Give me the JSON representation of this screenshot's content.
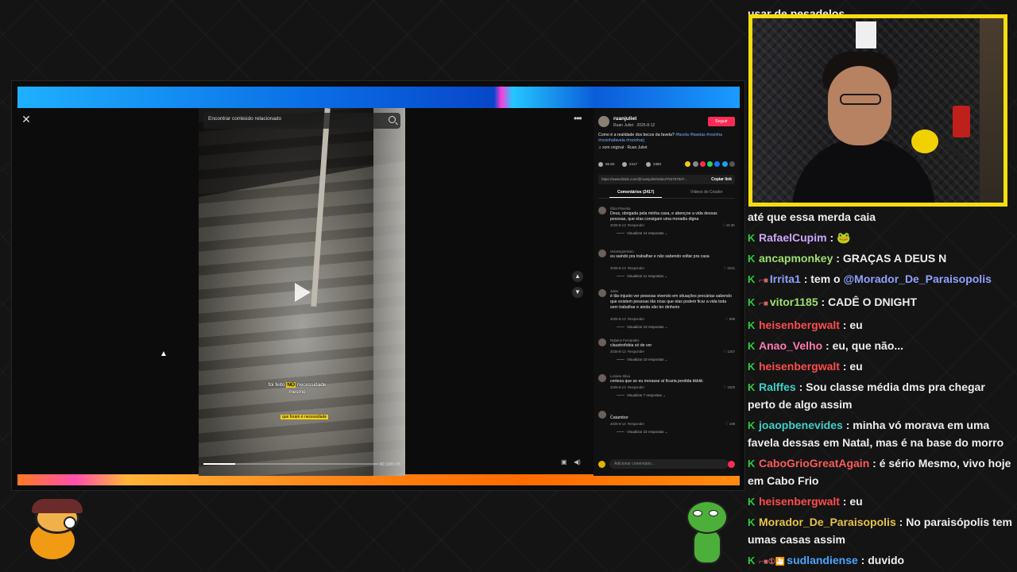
{
  "video": {
    "search_placeholder": "Encontrar conteúdo relacionado",
    "caption_prefix": "foi feito",
    "caption_highlight": "NO",
    "caption_suffix": "necessidade mesmo",
    "caption_small": "que foram é necessidade",
    "time": "00:13/01:05",
    "progress": 0.18
  },
  "panel": {
    "author": "ruanjuliet",
    "author_sub": "Ruan Juliet · 2025-8-12",
    "follow_label": "Seguir",
    "description": "Como é a realidade dos becos da favela?",
    "hashtags": "#favela #favelas #rocinha #rocinhafavela #rocinharj",
    "sound": "som original · Ruan Juliet",
    "likes": "96.5K",
    "comments_count": "2417",
    "saves": "2360",
    "link": "https://www.tiktok.com/@ruanjuliet/video/753787607...",
    "copy_link": "Copiar link",
    "tab_comments": "Comentários (2417)",
    "tab_creator": "Vídeos do Criador",
    "add_comment_placeholder": "Adicionar comentário..."
  },
  "comments": [
    {
      "user": "Ébia Pimenta",
      "text": "Deus, obrigada pela minha casa, e abençoe a vida dessas pessoas, que elas consigam uma moradia digna",
      "date": "2025-8-13",
      "reply": "Responder",
      "likes": "10.3K",
      "replies": "Visualizar 14 respostas"
    },
    {
      "user": "vivianegomesio",
      "text": "eu saindo pra trabalhar e não sabendo voltar pra casa",
      "date": "2025-8-13",
      "reply": "Responder",
      "likes": "2221",
      "replies": "Visualizar 11 respostas"
    },
    {
      "user": "Jules",
      "text": "é tão injusto ver pessoas vivendo em situações precárias sabendo que existem pessoas tão ricas que elas podem ficar a vida toda sem trabalhar e ainda vão ter dinheiro",
      "date": "2025-8-13",
      "reply": "Responder",
      "likes": "898",
      "replies": "Visualizar 23 respostas"
    },
    {
      "user": "Rubens Fernandes",
      "text": "claustrofobia só de ver",
      "date": "2025-8-13",
      "reply": "Responder",
      "likes": "1257",
      "replies": "Visualizar 10 respostas"
    },
    {
      "user": "Loraine Silva",
      "text": "certeza que se eu morasse aí ficaria perdida kkkkk",
      "date": "2025-8-13",
      "reply": "Responder",
      "likes": "1500",
      "replies": "Visualizar 7 respostas"
    },
    {
      "user": "_",
      "text": "Catambor",
      "date": "2025-8-14",
      "reply": "Responder",
      "likes": "109",
      "replies": "Visualizar 22 respostas"
    }
  ],
  "chat": {
    "top_cut": "usar de pesadelos",
    "messages": [
      {
        "user": "",
        "color": "#eeeeee",
        "text": "até que essa merda caia",
        "badges": ""
      },
      {
        "user": "RafaelCupim",
        "color": "#c9a8ff",
        "text": "🐸",
        "badges": ""
      },
      {
        "user": "ancapmonkey",
        "color": "#9ee06f",
        "text": "GRAÇAS A DEUS N",
        "badges": ""
      },
      {
        "user": "Irrita1",
        "color": "#8ea2ff",
        "text": "tem o ",
        "mention": "@Morador_De_Paraisopolis",
        "badges": "⌐■"
      },
      {
        "user": "vitor1185",
        "color": "#9ee06f",
        "text": "CADÊ O DNIGHT",
        "badges": "⌐■"
      },
      {
        "user": "heisenbergwalt",
        "color": "#ff4d4d",
        "text": "eu",
        "badges": ""
      },
      {
        "user": "Anao_Velho",
        "color": "#ff7bb0",
        "text": "eu, que não...",
        "badges": ""
      },
      {
        "user": "heisenbergwalt",
        "color": "#ff4d4d",
        "text": "eu",
        "badges": ""
      },
      {
        "user": "Ralffes",
        "color": "#3fd0c8",
        "text": "Sou classe média dms pra chegar perto de algo assim",
        "badges": ""
      },
      {
        "user": "joaopbenevides",
        "color": "#3fd0c8",
        "text": "minha vó morava em uma favela dessas em Natal, mas é na base do morro",
        "badges": ""
      },
      {
        "user": "CaboGrioGreatAgain",
        "color": "#ff5a5a",
        "text": "é sério Mesmo, vivo hoje em Cabo Frio",
        "badges": ""
      },
      {
        "user": "heisenbergwalt",
        "color": "#ff4d4d",
        "text": "eu",
        "badges": ""
      },
      {
        "user": "Morador_De_Paraisopolis",
        "color": "#e8c34a",
        "text": "No paraisópolis tem umas casas assim",
        "badges": ""
      },
      {
        "user": "sudlandiense",
        "color": "#4aa3ff",
        "text": "duvido",
        "badges": "⌐■①🎦"
      }
    ]
  },
  "colors": {
    "cam_border": "#f5dd10",
    "follow": "#fe2c55",
    "twitch_badge": "#2ecc40"
  }
}
